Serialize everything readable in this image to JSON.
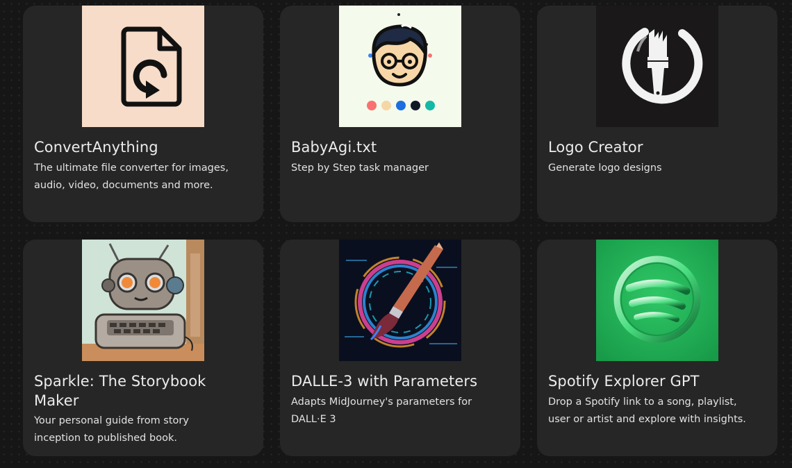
{
  "gpts": [
    {
      "title": "ConvertAnything",
      "description": "The ultimate file converter for images, audio, video, documents and more.",
      "icon": "file-convert-icon",
      "bg": "#f6dcc9"
    },
    {
      "title": " BabyAgi.txt",
      "description": "Step by Step task manager",
      "icon": "cartoon-boy-icon",
      "bg": "#f4fbec"
    },
    {
      "title": "Logo Creator",
      "description": "Generate logo designs",
      "icon": "paintbrush-circle-icon",
      "bg": "#1a1818"
    },
    {
      "title": "Sparkle: The Storybook Maker",
      "description": "Your personal guide from story inception to published book.",
      "icon": "robot-typewriter-icon",
      "bg": "#cfe6d8"
    },
    {
      "title": "DALLE-3 with Parameters",
      "description": "Adapts MidJourney's parameters for DALL·E 3",
      "icon": "neon-paintbrush-icon",
      "bg": "#0b1020"
    },
    {
      "title": "Spotify Explorer GPT",
      "description": "Drop a Spotify link to a song, playlist, user or artist and explore with insights.",
      "icon": "spotify-logo-icon",
      "bg": "#22b45a"
    }
  ]
}
